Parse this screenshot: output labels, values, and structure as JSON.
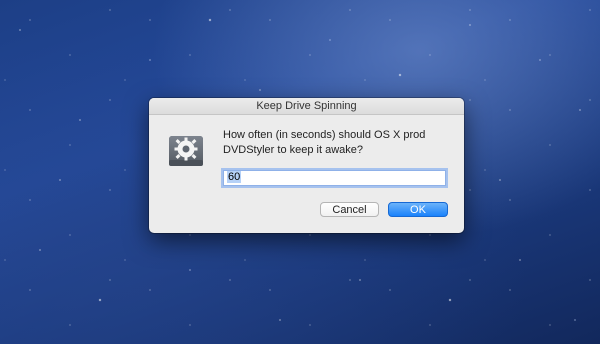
{
  "desktop": {
    "wallpaper": "starry-night-blue"
  },
  "dialog": {
    "title": "Keep Drive Spinning",
    "icon": "gear-drive-icon",
    "message_line1": "How often (in seconds) should OS X prod",
    "message_line2": "DVDStyler to keep it awake?",
    "input_value": "60",
    "cancel_label": "Cancel",
    "ok_label": "OK"
  },
  "colors": {
    "accent": "#1a82fb",
    "dialog_bg": "#ececec"
  }
}
